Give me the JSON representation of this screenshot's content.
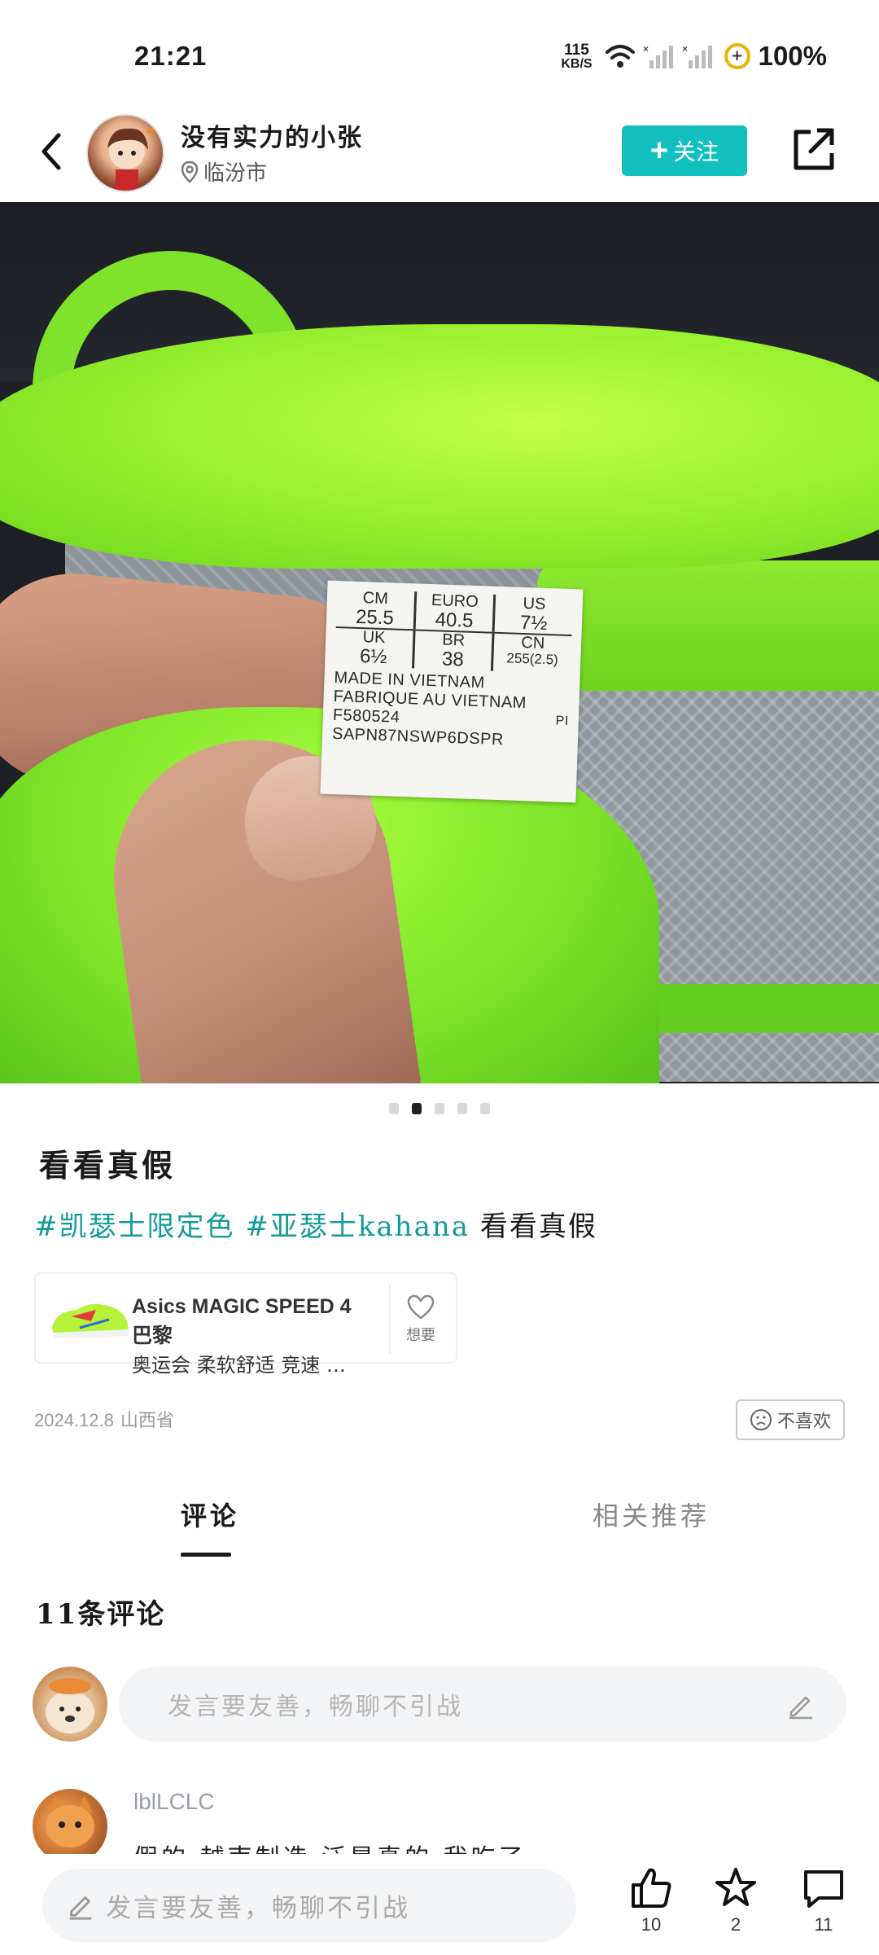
{
  "status_bar": {
    "time": "21:21",
    "net_speed_value": "115",
    "net_speed_unit": "KB/S",
    "battery": "100%"
  },
  "header": {
    "username": "没有实力的小张",
    "location": "临汾市",
    "follow_label": "关注"
  },
  "photo": {
    "label": {
      "row1": [
        {
          "k": "CM",
          "v": "25.5"
        },
        {
          "k": "EURO",
          "v": "40.5"
        },
        {
          "k": "US",
          "v": "7½"
        }
      ],
      "row2": [
        {
          "k": "UK",
          "v": "6½"
        },
        {
          "k": "BR",
          "v": "38"
        },
        {
          "k": "CN",
          "v": "255(2.5)"
        }
      ],
      "line1": "MADE IN VIETNAM",
      "line2": "FABRIQUE AU VIETNAM",
      "line3": "F580524",
      "line3_right": "PI",
      "line4": "SAPN87NSWP6DSPR"
    },
    "pager": {
      "count": 5,
      "active_index": 1
    }
  },
  "post": {
    "title": "看看真假",
    "tags": [
      "#凯瑟士限定色",
      "#亚瑟士kahana"
    ],
    "tail": "看看真假",
    "product": {
      "name_line1": "Asics MAGIC SPEED 4 巴黎",
      "name_line2": "奥运会 柔软舒适 竞速 …",
      "wish_label": "想要"
    },
    "date": "2024.12.8",
    "province": "山西省",
    "dislike_label": "不喜欢"
  },
  "tabs": {
    "comments": "评论",
    "related": "相关推荐"
  },
  "comments": {
    "count_label": "11条评论",
    "input_placeholder": "发言要友善，畅聊不引战",
    "items": [
      {
        "user": "lblLCLC",
        "text": "假的  越南制造  泛是真的  我吃了"
      }
    ]
  },
  "bottom_bar": {
    "placeholder": "发言要友善，畅聊不引战",
    "likes": "10",
    "favorites": "2",
    "comments": "11"
  },
  "colors": {
    "accent": "#11bfbf",
    "tag": "#139a9a",
    "shoe_green": "#9af230"
  },
  "icons": [
    "back-arrow-icon",
    "location-pin-icon",
    "plus-icon",
    "share-icon",
    "heart-icon",
    "sad-face-icon",
    "pencil-icon",
    "thumbs-up-icon",
    "star-icon",
    "comment-bubble-icon",
    "wifi-icon",
    "signal-icon",
    "battery-icon"
  ]
}
